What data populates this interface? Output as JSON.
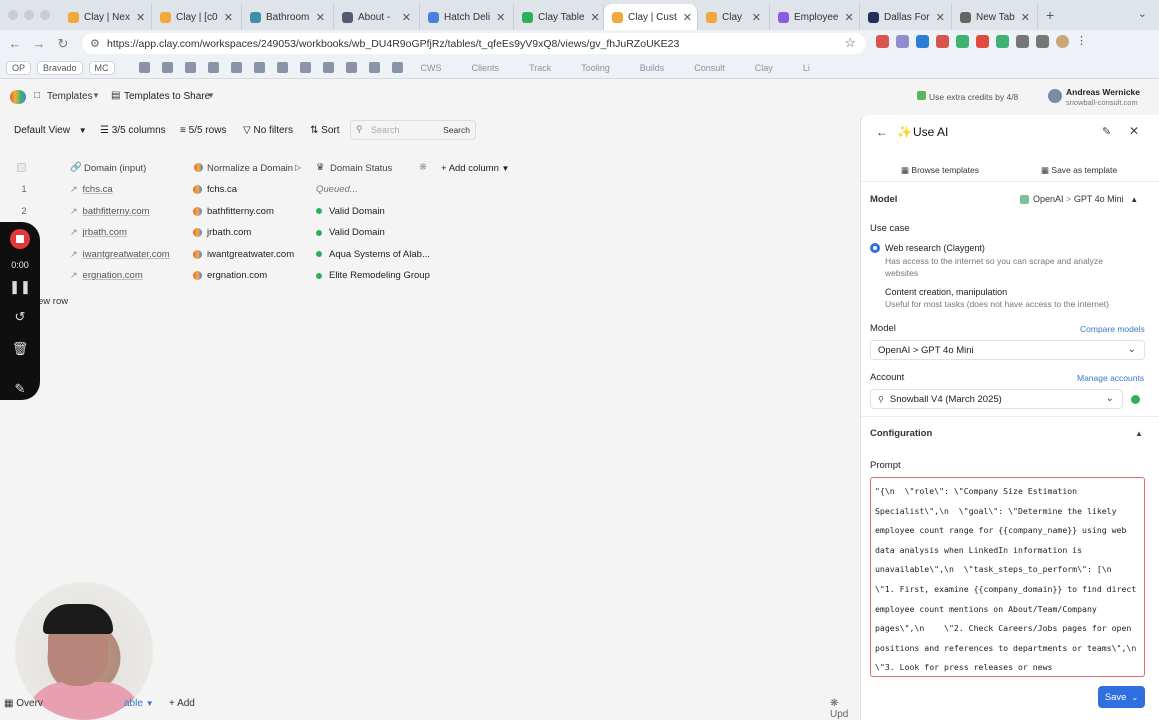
{
  "browser": {
    "tabs": [
      {
        "label": "Clay | Nex",
        "color": "#f2a93b",
        "active": false
      },
      {
        "label": "Clay | [c0",
        "color": "#f2a93b",
        "active": false
      },
      {
        "label": "Bathroom",
        "color": "#3f8fa8",
        "active": false
      },
      {
        "label": "About -",
        "color": "#555b6e",
        "active": false
      },
      {
        "label": "Hatch Deli",
        "color": "#4a7fe0",
        "active": false
      },
      {
        "label": "Clay Table",
        "color": "#2db05c",
        "active": false
      },
      {
        "label": "Clay | Cust",
        "color": "#f2a93b",
        "active": true
      },
      {
        "label": "Clay",
        "color": "#f2a93b",
        "active": false
      },
      {
        "label": "Employee",
        "color": "#8b5ce0",
        "active": false
      },
      {
        "label": "Dallas For",
        "color": "#22305a",
        "active": false
      },
      {
        "label": "New Tab",
        "color": "#666",
        "active": false
      }
    ],
    "new_tab_symbol": "+",
    "url": "https://app.clay.com/workspaces/249053/workbooks/wb_DU4R9oGPfjRz/tables/t_qfeEs9yV9xQ8/views/gv_fhJuRZoUKE23"
  },
  "bookmarks": {
    "pills": [
      "OP",
      "Bravado",
      "MC"
    ],
    "items": [
      "CWS",
      "Clients",
      "Track",
      "Tooling",
      "Builds",
      "Consult",
      "Clay",
      "Li"
    ]
  },
  "header": {
    "templates_label": "Templates",
    "breadcrumb_label": "Templates to Share",
    "credits_label": "Use extra credits by 4/8",
    "user_name": "Andreas Wernicke",
    "user_domain": "snowball-consult.com"
  },
  "toolbar": {
    "view_label": "Default View",
    "columns_label": "3/5 columns",
    "rows_label": "5/5 rows",
    "filters_label": "No filters",
    "sort_label": "Sort",
    "search_placeholder": "Search",
    "search_button": "Search"
  },
  "table": {
    "columns": [
      "Domain (input)",
      "Normalize a Domain",
      "Domain Status"
    ],
    "add_column_label": "Add column",
    "rows": [
      {
        "index": "1",
        "domain": "fchs.ca",
        "normalized": "fchs.ca",
        "status": "Queued...",
        "valid": false
      },
      {
        "index": "2",
        "domain": "bathfitterny.com",
        "normalized": "bathfitterny.com",
        "status": "Valid Domain",
        "valid": true
      },
      {
        "index": "3",
        "domain": "jrbath.com",
        "normalized": "jrbath.com",
        "status": "Valid Domain",
        "valid": true
      },
      {
        "index": "4",
        "domain": "iwantgreatwater.com",
        "normalized": "iwantgreatwater.com",
        "status": "Aqua Systems of Alab...",
        "valid": true
      },
      {
        "index": "5",
        "domain": "ergnation.com",
        "normalized": "ergnation.com",
        "status": "Elite Remodeling Group",
        "valid": true
      }
    ],
    "new_row_label": "ew row"
  },
  "recorder": {
    "timer": "0:00"
  },
  "bottom": {
    "overview_label": "Overv",
    "table_label": "able",
    "add_label": "Add",
    "update_label": "Upd"
  },
  "panel": {
    "title": "Use AI",
    "browse_templates": "Browse templates",
    "save_as_template": "Save as template",
    "model_section_label": "Model",
    "model_provider": "OpenAI",
    "model_name": "GPT 4o Mini",
    "use_case_label": "Use case",
    "use_case_options": [
      {
        "title": "Web research (Claygent)",
        "desc": "Has access to the internet so you can scrape and analyze websites",
        "selected": true
      },
      {
        "title": "Content creation, manipulation",
        "desc": "Useful for most tasks (does not have access to the internet)",
        "selected": false
      }
    ],
    "model_label": "Model",
    "compare_models": "Compare models",
    "model_select_value": "OpenAI > GPT 4o Mini",
    "account_label": "Account",
    "manage_accounts": "Manage accounts",
    "account_value": "Snowball V4 (March 2025)",
    "configuration_label": "Configuration",
    "prompt_label": "Prompt",
    "prompt_text": "\"{\\n  \\\"role\\\": \\\"Company Size Estimation Specialist\\\",\\n  \\\"goal\\\": \\\"Determine the likely employee count range for {{company_name}} using web data analysis when LinkedIn information is unavailable\\\",\\n  \\\"task_steps_to_perform\\\": [\\n    \\\"1. First, examine {{company_domain}} to find direct employee count mentions on About/Team/Company pages\\\",\\n    \\\"2. Check Careers/Jobs pages for open positions and references to departments or teams\\\",\\n    \\\"3. Look for press releases or news",
    "save_label": "Save",
    "colors": {
      "accent": "#2f6fe0",
      "prompt_border": "#e06b6b",
      "valid": "#2db05c"
    }
  }
}
